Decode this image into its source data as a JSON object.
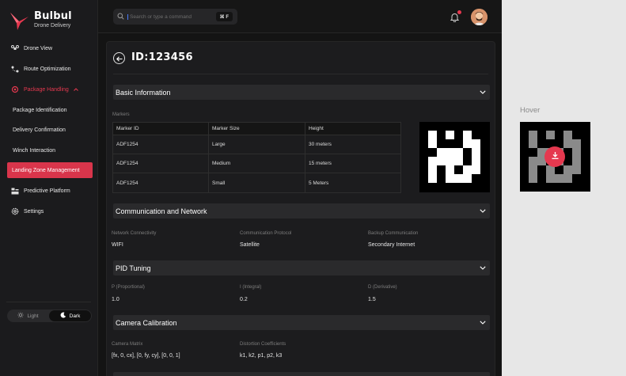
{
  "brand": {
    "name": "Bulbul",
    "subtitle": "Drone Delivery"
  },
  "sidebar": {
    "items": [
      {
        "label": "Drone View",
        "icon": "drone-icon"
      },
      {
        "label": "Route Optimization",
        "icon": "route-icon"
      },
      {
        "label": "Package Handling",
        "icon": "package-icon",
        "expanded": true
      },
      {
        "label": "Package Identification"
      },
      {
        "label": "Delivery Confirmation"
      },
      {
        "label": "Winch Interaction"
      },
      {
        "label": "Landing Zone Management",
        "selected": true
      },
      {
        "label": "Predictive Platform",
        "icon": "platform-icon"
      },
      {
        "label": "Settings",
        "icon": "gear-icon"
      }
    ],
    "theme": {
      "light_label": "Light",
      "dark_label": "Dark",
      "selected": "Dark"
    }
  },
  "topbar": {
    "search_placeholder": "Search or type a command",
    "shortcut": "⌘ F"
  },
  "page": {
    "title": "ID:123456"
  },
  "basic_info": {
    "heading": "Basic Information",
    "markers_label": "Markers",
    "columns": [
      "Marker ID",
      "Marker Size",
      "Height"
    ],
    "rows": [
      [
        "ADF1254",
        "Large",
        "30 meters"
      ],
      [
        "ADF1254",
        "Medium",
        "15 meters"
      ],
      [
        "ADF1254",
        "Small",
        "5 Meters"
      ]
    ]
  },
  "communication": {
    "heading": "Communication and Network",
    "fields": [
      {
        "label": "Network Connectivity",
        "value": "WIFI"
      },
      {
        "label": "Communication Protocol",
        "value": "Satellite"
      },
      {
        "label": "Backup Communication",
        "value": "Secondary Internet"
      }
    ]
  },
  "pid": {
    "heading": "PID Tuning",
    "fields": [
      {
        "label": "P (Proportional)",
        "value": "1.0"
      },
      {
        "label": "I (Integral)",
        "value": "0.2"
      },
      {
        "label": "D (Derivative)",
        "value": "1.5"
      }
    ]
  },
  "camera": {
    "heading": "Camera Calibration",
    "fields": [
      {
        "label": "Camera Matrix",
        "value": "[fx, 0, cx], [0, fy, cy], [0, 0, 1]"
      },
      {
        "label": "Distortion Coefficients",
        "value": "k1, k2, p1, p2, k3"
      }
    ]
  },
  "hover_demo": {
    "label": "Hover"
  },
  "colors": {
    "accent": "#e5384f",
    "background": "#141414",
    "panel": "#1c1c1e",
    "section": "#2a2a2c"
  }
}
